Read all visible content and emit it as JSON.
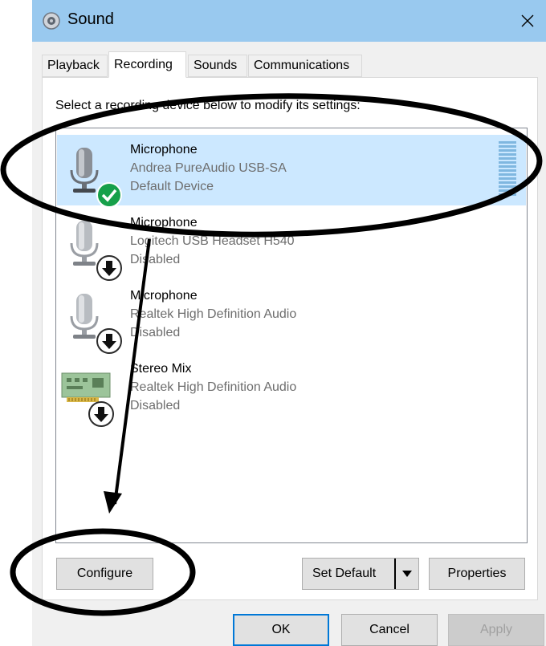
{
  "window": {
    "title": "Sound",
    "icons": {
      "title": "speaker-icon",
      "close": "close-icon"
    },
    "colors": {
      "titlebar": "#99c9ef",
      "selection": "#cce8ff",
      "accent": "#0078d7",
      "check": "#16a04a"
    }
  },
  "tabs": [
    {
      "label": "Playback",
      "active": false
    },
    {
      "label": "Recording",
      "active": true
    },
    {
      "label": "Sounds",
      "active": false
    },
    {
      "label": "Communications",
      "active": false
    }
  ],
  "recording": {
    "instruction": "Select a recording device below to modify its settings:",
    "devices": [
      {
        "name": "Microphone",
        "description": "Andrea PureAudio USB-SA",
        "status": "Default Device",
        "selected": true,
        "icon": "microphone-icon",
        "badge": "checkmark-icon"
      },
      {
        "name": "Microphone",
        "description": "Logitech USB Headset H540",
        "status": "Disabled",
        "selected": false,
        "icon": "microphone-icon",
        "badge": "down-arrow-icon"
      },
      {
        "name": "Microphone",
        "description": "Realtek High Definition Audio",
        "status": "Disabled",
        "selected": false,
        "icon": "microphone-icon",
        "badge": "down-arrow-icon"
      },
      {
        "name": "Stereo Mix",
        "description": "Realtek High Definition Audio",
        "status": "Disabled",
        "selected": false,
        "icon": "sound-card-icon",
        "badge": "down-arrow-icon"
      }
    ]
  },
  "buttons": {
    "configure": "Configure",
    "set_default": "Set Default",
    "properties": "Properties",
    "ok": "OK",
    "cancel": "Cancel",
    "apply": "Apply"
  }
}
